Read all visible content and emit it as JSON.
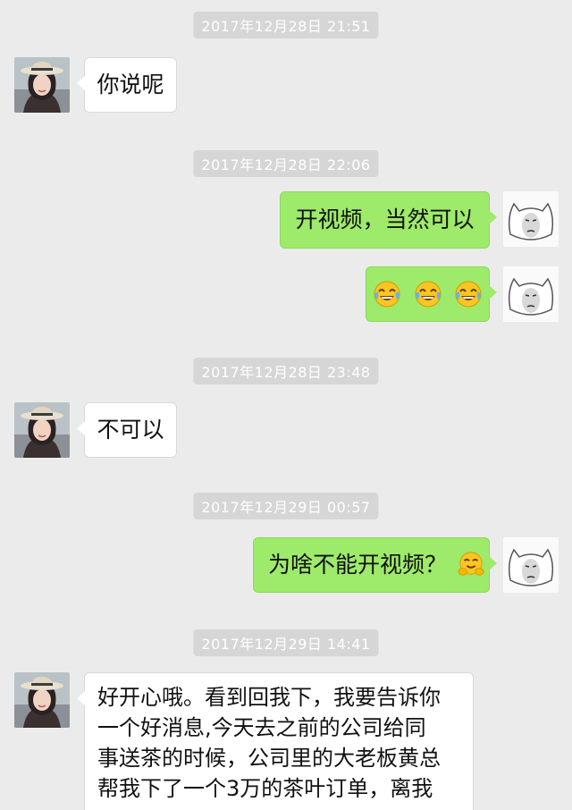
{
  "colors": {
    "background": "#ebebeb",
    "timestamp_bg": "#d6d6d6",
    "incoming_bubble": "#ffffff",
    "outgoing_bubble": "#9eea6a"
  },
  "messages": [
    {
      "timestamp": "2017年12月28日 21:51"
    },
    {
      "from": "contact",
      "text": "你说呢"
    },
    {
      "timestamp": "2017年12月28日 22:06"
    },
    {
      "from": "me",
      "text": "开视频，当然可以"
    },
    {
      "from": "me",
      "emoji": "tears-of-joy-emoji",
      "count": 3
    },
    {
      "timestamp": "2017年12月28日 23:48"
    },
    {
      "from": "contact",
      "text": "不可以"
    },
    {
      "timestamp": "2017年12月29日 00:57"
    },
    {
      "from": "me",
      "text": "为啥不能开视频？",
      "emoji": "hugging-face-emoji"
    },
    {
      "timestamp": "2017年12月29日 14:41"
    },
    {
      "from": "contact",
      "lines": [
        "好开心哦。看到回我下，我要告诉你",
        "一个好消息,今天去之前的公司给同",
        "事送茶的时候，公司里的大老板黄总",
        "帮我下了一个3万的茶叶订单，离我"
      ]
    }
  ],
  "avatars": {
    "contact": "girl-with-hat-avatar",
    "me": "cartoon-cat-face-avatar"
  }
}
